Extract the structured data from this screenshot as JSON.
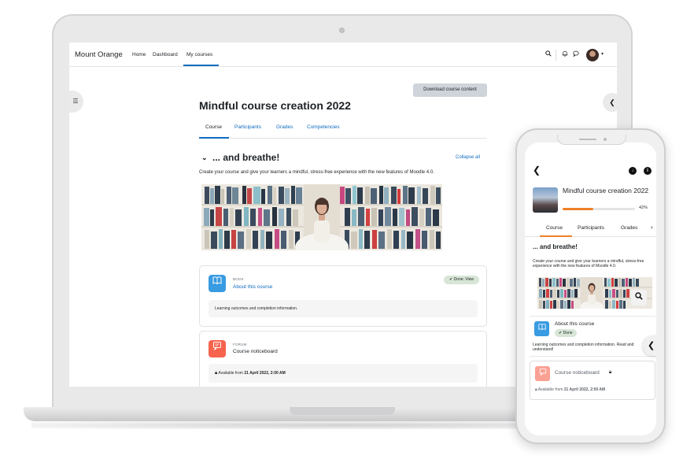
{
  "laptop": {
    "navbar": {
      "brand": "Mount Orange",
      "links": [
        "Home",
        "Dashboard",
        "My courses"
      ],
      "active_link": "My courses",
      "icons": [
        "search-icon",
        "bell-icon",
        "chat-icon",
        "avatar",
        "chevron-down-icon"
      ]
    },
    "download_button": "Download course content",
    "course_title": "Mindful course creation 2022",
    "tabs": [
      "Course",
      "Participants",
      "Grades",
      "Competencies"
    ],
    "active_tab": "Course",
    "section": {
      "title": "... and breathe!",
      "collapse_label": "Collapse all",
      "summary": "Create your course and give your learners a mindful, stress-free experience with the new features of Moodle 4.0."
    },
    "activities": [
      {
        "type": "BOOK",
        "name": "About this course",
        "completion": "✔ Done: View",
        "description": "Learning outcomes and completion information.",
        "icon": "book-icon",
        "color": "#399be2"
      },
      {
        "type": "FORUM",
        "name": "Course noticeboard",
        "restriction_prefix": "Available from",
        "restriction_date": "21 April 2022, 2:00 AM",
        "icon": "forum-icon",
        "color": "#f7634d"
      }
    ]
  },
  "phone": {
    "course_title": "Mindful course creation 2022",
    "progress_label": "42%",
    "progress_value": 0.42,
    "tabs": [
      "Course",
      "Participants",
      "Grades"
    ],
    "active_tab": "Course",
    "section_title": "... and breathe!",
    "summary": "Create your course and give your learners a mindful, stress-free experience with the new features of Moodle 4.0.",
    "activity_1": {
      "name": "About this course",
      "status": "Done",
      "description": "Learning outcomes and completion information. Read and understand!"
    },
    "activity_2": {
      "name": "Course noticeboard",
      "restriction_prefix": "Available from",
      "restriction_date": "21 April 2022, 2:00 AM"
    }
  },
  "colors": {
    "link": "#0f6cbf",
    "progress": "#f07f26",
    "book": "#399be2",
    "forum": "#f7634d"
  }
}
